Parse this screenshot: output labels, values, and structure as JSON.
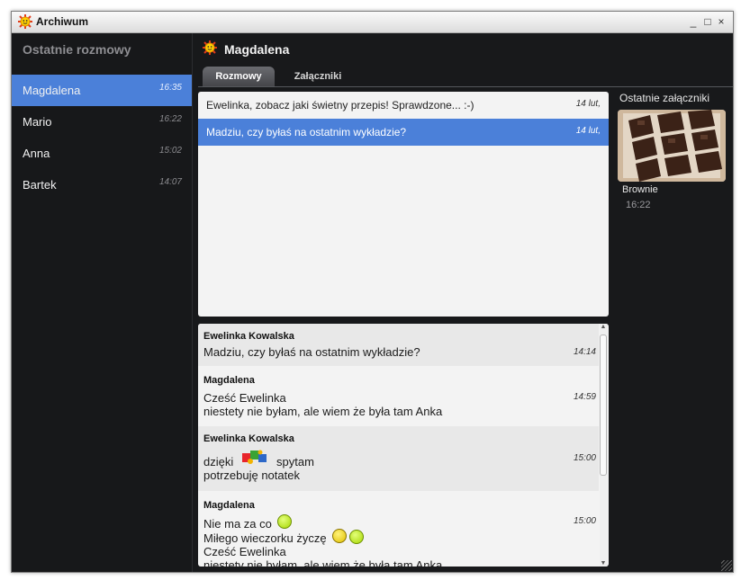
{
  "window": {
    "title": "Archiwum",
    "controls": [
      "_",
      "□",
      "×"
    ]
  },
  "sidebar": {
    "title": "Ostatnie rozmowy",
    "items": [
      {
        "name": "Magdalena",
        "time": "16:35",
        "active": true
      },
      {
        "name": "Mario",
        "time": "16:22"
      },
      {
        "name": "Anna",
        "time": "15:02"
      },
      {
        "name": "Bartek",
        "time": "14:07"
      }
    ]
  },
  "header": {
    "contact": "Magdalena"
  },
  "tabs": [
    {
      "label": "Rozmowy",
      "active": true
    },
    {
      "label": "Załączniki"
    }
  ],
  "conversations": [
    {
      "text": "Ewelinka, zobacz jaki świetny przepis! Sprawdzone... :-)",
      "date": "14 lut,"
    },
    {
      "text": "Madziu, czy byłaś na ostatnim wykładzie?",
      "date": "14 lut,",
      "selected": true
    }
  ],
  "attachments": {
    "title": "Ostatnie załączniki",
    "items": [
      {
        "name": "Brownie",
        "time": "16:22"
      }
    ]
  },
  "messages": [
    {
      "sender": "Ewelinka Kowalska",
      "time": "14:14",
      "lines": [
        "Madziu, czy byłaś na ostatnim wykładzie?"
      ]
    },
    {
      "sender": "Magdalena",
      "time": "14:59",
      "lines": [
        "Cześć Ewelinka",
        "niestety nie byłam, ale wiem że była tam Anka"
      ]
    },
    {
      "sender": "Ewelinka Kowalska",
      "time": "15:00",
      "lines": [
        "dzięki",
        "spytam",
        "potrzebuję notatek"
      ]
    },
    {
      "sender": "Magdalena",
      "time": "15:00",
      "lines": [
        "Nie ma za co",
        "Miłego wieczorku życzę",
        "Cześć Ewelinka",
        "niestety nie byłam, ale wiem że była tam Anka"
      ]
    }
  ],
  "icons": {
    "app": "sun-icon",
    "emoticons": [
      "puzzle-icon",
      "smile-icon",
      "grin-icon",
      "wink-icon"
    ]
  },
  "colors": {
    "accent": "#4b80d9",
    "background": "#18191b"
  }
}
